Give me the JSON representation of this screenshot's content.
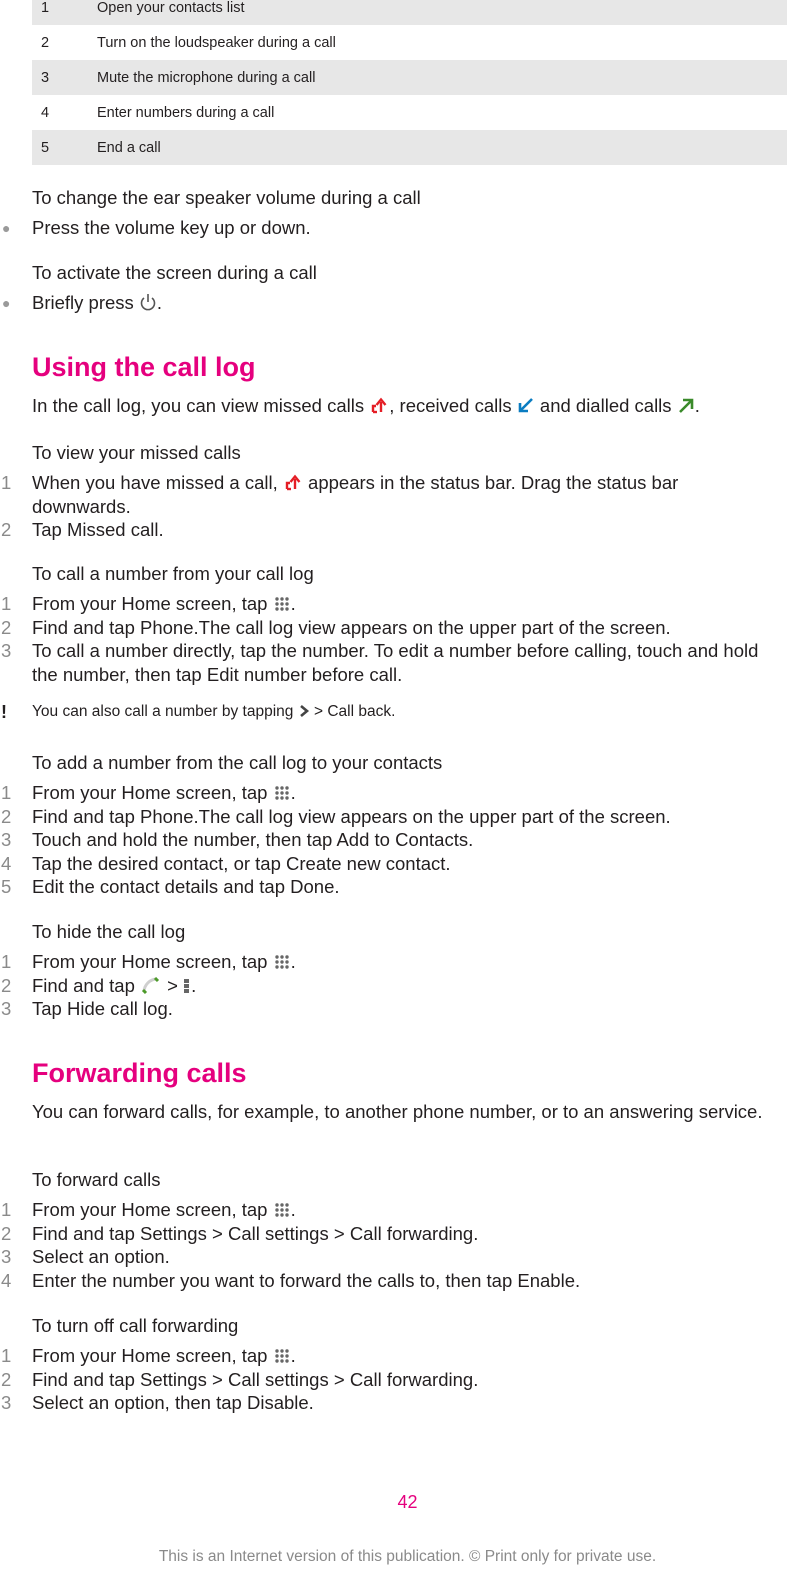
{
  "key_table": [
    {
      "num": "1",
      "text": "Open your contacts list"
    },
    {
      "num": "2",
      "text": "Turn on the loudspeaker during a call"
    },
    {
      "num": "3",
      "text": "Mute the microphone during a call"
    },
    {
      "num": "4",
      "text": "Enter numbers during a call"
    },
    {
      "num": "5",
      "text": "End a call"
    }
  ],
  "ear_volume": {
    "title": "To change the ear speaker volume during a call",
    "bullet": "Press the volume key up or down."
  },
  "activate_screen": {
    "title": "To activate the screen during a call",
    "bullet_pre": "Briefly press ",
    "bullet_icon": "power-icon",
    "bullet_post": "."
  },
  "call_log": {
    "heading": "Using the call log",
    "intro_1": "In the call log, you can view missed calls ",
    "intro_2": ", received calls ",
    "intro_3": " and dialled calls ",
    "intro_4": ".",
    "icons": {
      "missed": "missed-call-icon",
      "received": "received-call-icon",
      "dialled": "dialled-call-icon"
    },
    "colors": {
      "missed": "#e41e26",
      "received": "#0a7cc1",
      "dialled": "#3a8a2a"
    }
  },
  "view_missed": {
    "title": "To view your missed calls",
    "steps": [
      {
        "n": "1",
        "pre": "When you have missed a call, ",
        "post": " appears in the status bar. Drag the status bar downwards."
      },
      {
        "n": "2",
        "pre": "Tap ",
        "bold": "Missed call",
        "post": "."
      }
    ]
  },
  "call_from_log": {
    "title": "To call a number from your call log",
    "steps": [
      {
        "n": "1",
        "pre": "From your Home screen, tap ",
        "post": "."
      },
      {
        "n": "2",
        "pre": "Find and tap ",
        "bold": "Phone",
        "post": ".The call log view appears on the upper part of the screen."
      },
      {
        "n": "3",
        "pre": "To call a number directly, tap the number. To edit a number before calling, touch and hold the number, then tap ",
        "bold": "Edit number before call",
        "post": "."
      }
    ],
    "note": {
      "mark": "!",
      "pre": "You can also call a number by tapping ",
      "mid": " > ",
      "bold": "Call back",
      "post": "."
    }
  },
  "add_to_contacts": {
    "title": "To add a number from the call log to your contacts",
    "steps": [
      {
        "n": "1",
        "pre": "From your Home screen, tap ",
        "post": "."
      },
      {
        "n": "2",
        "pre": "Find and tap ",
        "bold": "Phone",
        "post": ".The call log view appears on the upper part of the screen."
      },
      {
        "n": "3",
        "pre": "Touch and hold the number, then tap ",
        "bold": "Add to Contacts",
        "post": "."
      },
      {
        "n": "4",
        "pre": "Tap the desired contact, or tap ",
        "bold": "Create new contact",
        "post": "."
      },
      {
        "n": "5",
        "pre": "Edit the contact details and tap ",
        "bold": "Done",
        "post": "."
      }
    ]
  },
  "hide_log": {
    "title": "To hide the call log",
    "steps": [
      {
        "n": "1",
        "pre": "From your Home screen, tap ",
        "post": "."
      },
      {
        "n": "2",
        "pre": "Find and tap ",
        "mid": " > ",
        "post": "."
      },
      {
        "n": "3",
        "pre": "Tap ",
        "bold": "Hide call log",
        "post": "."
      }
    ]
  },
  "forwarding": {
    "heading": "Forwarding calls",
    "intro": "You can forward calls, for example, to another phone number, or to an answering service."
  },
  "forward_calls": {
    "title": "To forward calls",
    "steps": [
      {
        "n": "1",
        "pre": "From your Home screen, tap ",
        "post": "."
      },
      {
        "n": "2",
        "pre": "Find and tap ",
        "b1": "Settings",
        "s1": " > ",
        "b2": "Call settings",
        "s2": " > ",
        "b3": "Call forwarding",
        "post": "."
      },
      {
        "n": "3",
        "pre": "Select an option."
      },
      {
        "n": "4",
        "pre": "Enter the number you want to forward the calls to, then tap ",
        "bold": "Enable",
        "post": "."
      }
    ]
  },
  "turn_off_forwarding": {
    "title": "To turn off call forwarding",
    "steps": [
      {
        "n": "1",
        "pre": "From your Home screen, tap ",
        "post": "."
      },
      {
        "n": "2",
        "pre": "Find and tap ",
        "b1": "Settings",
        "s1": " > ",
        "b2": "Call settings",
        "s2": " > ",
        "b3": "Call forwarding",
        "post": "."
      },
      {
        "n": "3",
        "pre": "Select an option, then tap ",
        "bold": "Disable",
        "post": "."
      }
    ]
  },
  "page_number": "42",
  "footer": "This is an Internet version of this publication. © Print only for private use.",
  "colors": {
    "accent": "#e5007e",
    "table_shade": "#e7e7e7",
    "text": "#231f20",
    "muted": "#8a8a8a"
  }
}
